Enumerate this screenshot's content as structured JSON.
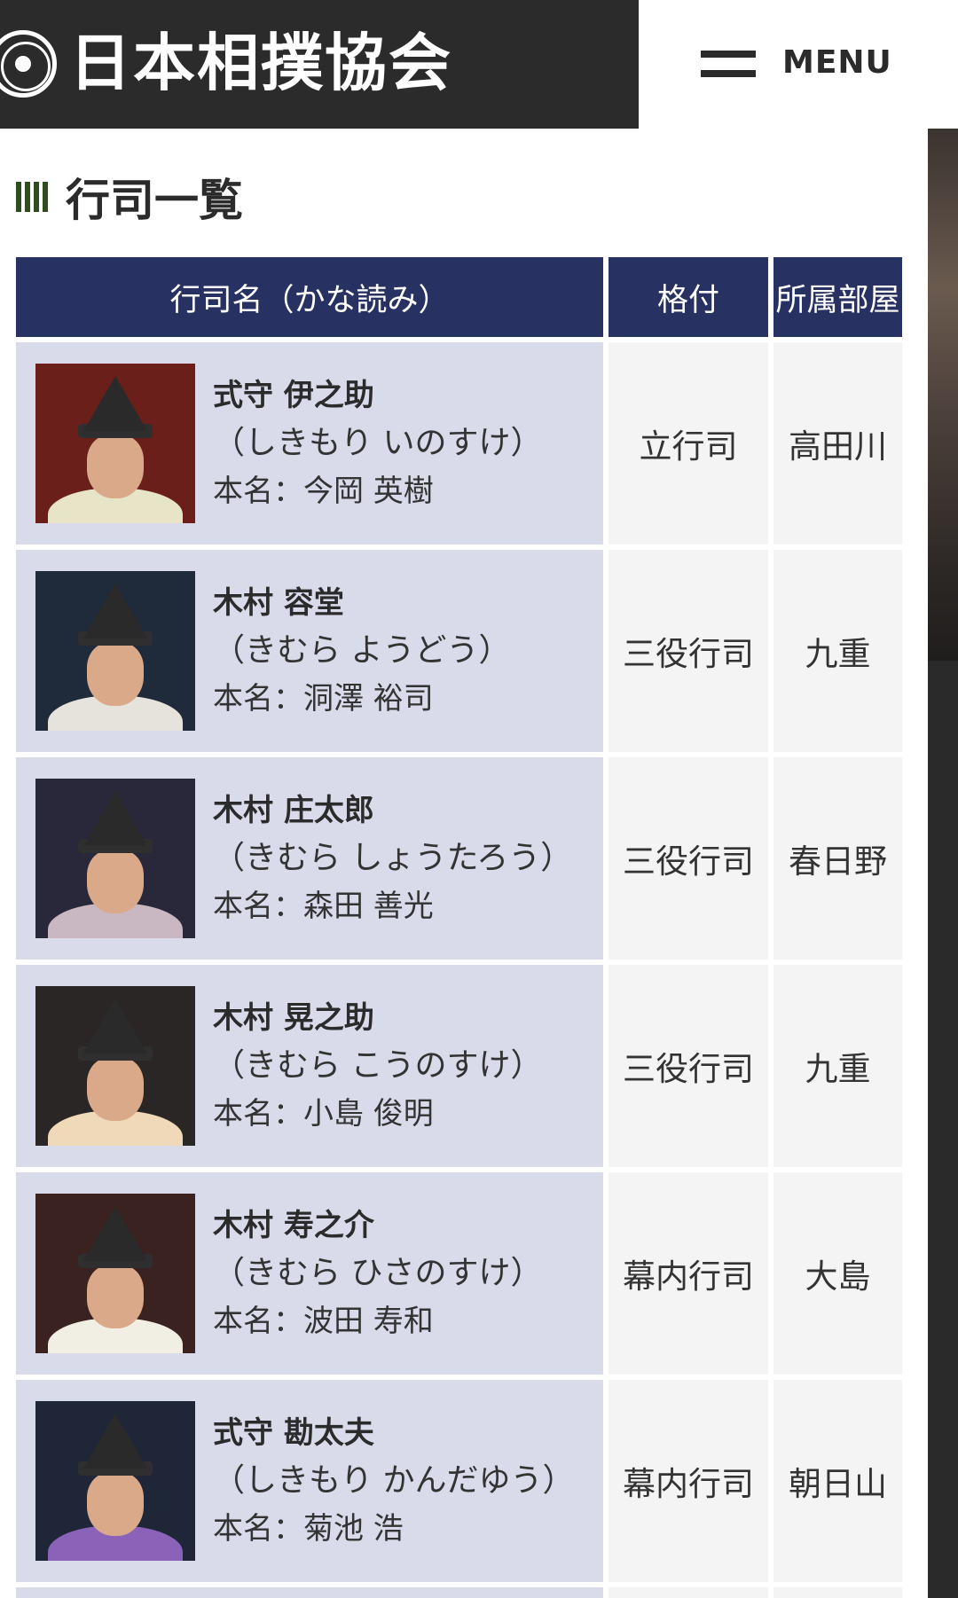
{
  "header": {
    "logo_text": "日本相撲協会",
    "menu_label": "MENU"
  },
  "page": {
    "title": "行司一覧"
  },
  "table": {
    "columns": [
      "行司名（かな読み）",
      "格付",
      "所属部屋"
    ],
    "rows": [
      {
        "name": "式守 伊之助",
        "kana": "（しきもり いのすけ）",
        "real_name": "本名：今岡 英樹",
        "rank": "立行司",
        "stable": "高田川",
        "bg": "#6b1f1a",
        "robe": "#e8e4c8"
      },
      {
        "name": "木村 容堂",
        "kana": "（きむら ようどう）",
        "real_name": "本名：洞澤 裕司",
        "rank": "三役行司",
        "stable": "九重",
        "bg": "#1f2a3a",
        "robe": "#e6e2dc"
      },
      {
        "name": "木村 庄太郎",
        "kana": "（きむら しょうたろう）",
        "real_name": "本名：森田 善光",
        "rank": "三役行司",
        "stable": "春日野",
        "bg": "#28283a",
        "robe": "#c9b8c2"
      },
      {
        "name": "木村 晃之助",
        "kana": "（きむら こうのすけ）",
        "real_name": "本名：小島 俊明",
        "rank": "三役行司",
        "stable": "九重",
        "bg": "#2b2626",
        "robe": "#efd9b8"
      },
      {
        "name": "木村 寿之介",
        "kana": "（きむら ひさのすけ）",
        "real_name": "本名：波田 寿和",
        "rank": "幕内行司",
        "stable": "大島",
        "bg": "#3a2220",
        "robe": "#f1eee4"
      },
      {
        "name": "式守 勘太夫",
        "kana": "（しきもり かんだゆう）",
        "real_name": "本名：菊池 浩",
        "rank": "幕内行司",
        "stable": "朝日山",
        "bg": "#1e2638",
        "robe": "#8a62b8"
      }
    ]
  }
}
